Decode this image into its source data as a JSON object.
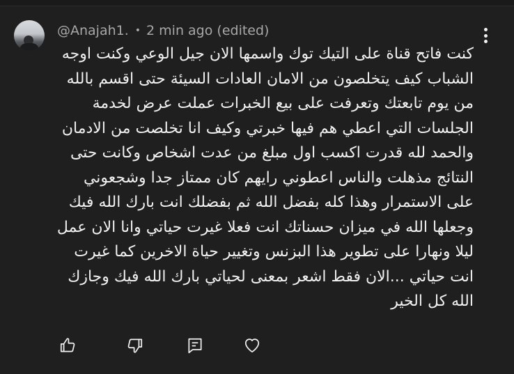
{
  "comment": {
    "author": "@Anajah1.",
    "separator": "•",
    "timestamp": "2 min ago (edited)",
    "lines": [
      "كنت فاتح قناة على التيك توك واسمها الان جيل الوعي وكنت اوجه",
      "الشباب كيف يتخلصون من الامان العادات السيئة حتى اقسم بالله",
      "من يوم تابعتك وتعرفت على بيع الخبرات عملت عرض لخدمة",
      "الجلسات التي اعطي هم فيها خبرتي وكيف انا تخلصت من الادمان",
      "والحمد لله قدرت اكسب اول مبلغ من عدت اشخاص وكانت حتى",
      "النتائج مذهلت والناس اعطوني رايهم كان ممتاز جدا وشجعوني",
      "على الاستمرار وهذا كله  بفضل الله ثم بفضلك انت بارك الله فيك",
      "وجعلها الله في ميزان حسناتك انت فعلا غيرت حياتي وانا الان عمل",
      "ليلا ونهارا على تطوير هذا البزنس وتغيير حياة الاخرين كما غيرت",
      "انت حياتي ...الان فقط اشعر بمعنى لحياتي بارك الله فيك وجازك",
      "الله كل الخير"
    ]
  },
  "icons": {
    "more": "more-vert-icon",
    "like": "thumbs-up-icon",
    "dislike": "thumbs-down-icon",
    "reply": "reply-comment-icon",
    "heart": "heart-icon"
  },
  "colors": {
    "background": "#1f1f1f",
    "text_primary": "#f1f1f1",
    "text_secondary": "#a8a8a8"
  }
}
